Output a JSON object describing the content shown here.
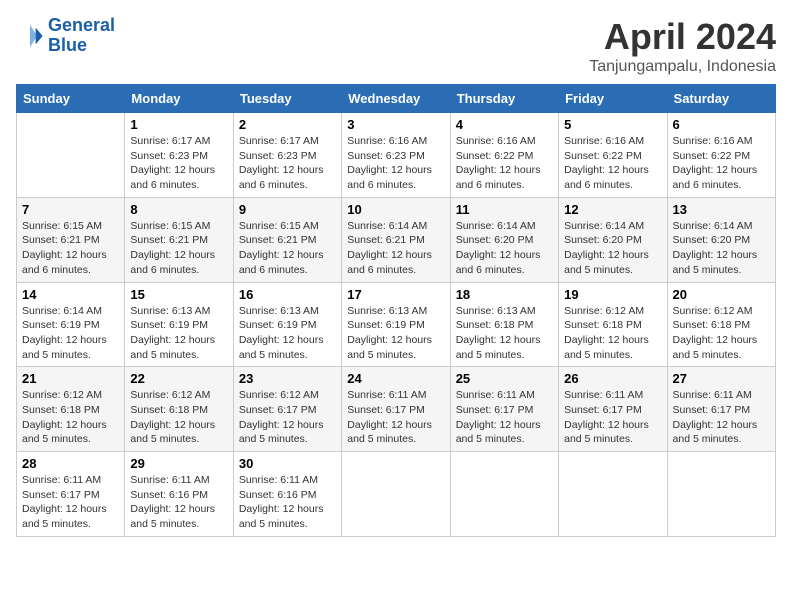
{
  "header": {
    "logo_line1": "General",
    "logo_line2": "Blue",
    "month": "April 2024",
    "location": "Tanjungampalu, Indonesia"
  },
  "columns": [
    "Sunday",
    "Monday",
    "Tuesday",
    "Wednesday",
    "Thursday",
    "Friday",
    "Saturday"
  ],
  "weeks": [
    [
      {
        "day": "",
        "sunrise": "",
        "sunset": "",
        "daylight": ""
      },
      {
        "day": "1",
        "sunrise": "Sunrise: 6:17 AM",
        "sunset": "Sunset: 6:23 PM",
        "daylight": "Daylight: 12 hours and 6 minutes."
      },
      {
        "day": "2",
        "sunrise": "Sunrise: 6:17 AM",
        "sunset": "Sunset: 6:23 PM",
        "daylight": "Daylight: 12 hours and 6 minutes."
      },
      {
        "day": "3",
        "sunrise": "Sunrise: 6:16 AM",
        "sunset": "Sunset: 6:23 PM",
        "daylight": "Daylight: 12 hours and 6 minutes."
      },
      {
        "day": "4",
        "sunrise": "Sunrise: 6:16 AM",
        "sunset": "Sunset: 6:22 PM",
        "daylight": "Daylight: 12 hours and 6 minutes."
      },
      {
        "day": "5",
        "sunrise": "Sunrise: 6:16 AM",
        "sunset": "Sunset: 6:22 PM",
        "daylight": "Daylight: 12 hours and 6 minutes."
      },
      {
        "day": "6",
        "sunrise": "Sunrise: 6:16 AM",
        "sunset": "Sunset: 6:22 PM",
        "daylight": "Daylight: 12 hours and 6 minutes."
      }
    ],
    [
      {
        "day": "7",
        "sunrise": "Sunrise: 6:15 AM",
        "sunset": "Sunset: 6:21 PM",
        "daylight": "Daylight: 12 hours and 6 minutes."
      },
      {
        "day": "8",
        "sunrise": "Sunrise: 6:15 AM",
        "sunset": "Sunset: 6:21 PM",
        "daylight": "Daylight: 12 hours and 6 minutes."
      },
      {
        "day": "9",
        "sunrise": "Sunrise: 6:15 AM",
        "sunset": "Sunset: 6:21 PM",
        "daylight": "Daylight: 12 hours and 6 minutes."
      },
      {
        "day": "10",
        "sunrise": "Sunrise: 6:14 AM",
        "sunset": "Sunset: 6:21 PM",
        "daylight": "Daylight: 12 hours and 6 minutes."
      },
      {
        "day": "11",
        "sunrise": "Sunrise: 6:14 AM",
        "sunset": "Sunset: 6:20 PM",
        "daylight": "Daylight: 12 hours and 6 minutes."
      },
      {
        "day": "12",
        "sunrise": "Sunrise: 6:14 AM",
        "sunset": "Sunset: 6:20 PM",
        "daylight": "Daylight: 12 hours and 5 minutes."
      },
      {
        "day": "13",
        "sunrise": "Sunrise: 6:14 AM",
        "sunset": "Sunset: 6:20 PM",
        "daylight": "Daylight: 12 hours and 5 minutes."
      }
    ],
    [
      {
        "day": "14",
        "sunrise": "Sunrise: 6:14 AM",
        "sunset": "Sunset: 6:19 PM",
        "daylight": "Daylight: 12 hours and 5 minutes."
      },
      {
        "day": "15",
        "sunrise": "Sunrise: 6:13 AM",
        "sunset": "Sunset: 6:19 PM",
        "daylight": "Daylight: 12 hours and 5 minutes."
      },
      {
        "day": "16",
        "sunrise": "Sunrise: 6:13 AM",
        "sunset": "Sunset: 6:19 PM",
        "daylight": "Daylight: 12 hours and 5 minutes."
      },
      {
        "day": "17",
        "sunrise": "Sunrise: 6:13 AM",
        "sunset": "Sunset: 6:19 PM",
        "daylight": "Daylight: 12 hours and 5 minutes."
      },
      {
        "day": "18",
        "sunrise": "Sunrise: 6:13 AM",
        "sunset": "Sunset: 6:18 PM",
        "daylight": "Daylight: 12 hours and 5 minutes."
      },
      {
        "day": "19",
        "sunrise": "Sunrise: 6:12 AM",
        "sunset": "Sunset: 6:18 PM",
        "daylight": "Daylight: 12 hours and 5 minutes."
      },
      {
        "day": "20",
        "sunrise": "Sunrise: 6:12 AM",
        "sunset": "Sunset: 6:18 PM",
        "daylight": "Daylight: 12 hours and 5 minutes."
      }
    ],
    [
      {
        "day": "21",
        "sunrise": "Sunrise: 6:12 AM",
        "sunset": "Sunset: 6:18 PM",
        "daylight": "Daylight: 12 hours and 5 minutes."
      },
      {
        "day": "22",
        "sunrise": "Sunrise: 6:12 AM",
        "sunset": "Sunset: 6:18 PM",
        "daylight": "Daylight: 12 hours and 5 minutes."
      },
      {
        "day": "23",
        "sunrise": "Sunrise: 6:12 AM",
        "sunset": "Sunset: 6:17 PM",
        "daylight": "Daylight: 12 hours and 5 minutes."
      },
      {
        "day": "24",
        "sunrise": "Sunrise: 6:11 AM",
        "sunset": "Sunset: 6:17 PM",
        "daylight": "Daylight: 12 hours and 5 minutes."
      },
      {
        "day": "25",
        "sunrise": "Sunrise: 6:11 AM",
        "sunset": "Sunset: 6:17 PM",
        "daylight": "Daylight: 12 hours and 5 minutes."
      },
      {
        "day": "26",
        "sunrise": "Sunrise: 6:11 AM",
        "sunset": "Sunset: 6:17 PM",
        "daylight": "Daylight: 12 hours and 5 minutes."
      },
      {
        "day": "27",
        "sunrise": "Sunrise: 6:11 AM",
        "sunset": "Sunset: 6:17 PM",
        "daylight": "Daylight: 12 hours and 5 minutes."
      }
    ],
    [
      {
        "day": "28",
        "sunrise": "Sunrise: 6:11 AM",
        "sunset": "Sunset: 6:17 PM",
        "daylight": "Daylight: 12 hours and 5 minutes."
      },
      {
        "day": "29",
        "sunrise": "Sunrise: 6:11 AM",
        "sunset": "Sunset: 6:16 PM",
        "daylight": "Daylight: 12 hours and 5 minutes."
      },
      {
        "day": "30",
        "sunrise": "Sunrise: 6:11 AM",
        "sunset": "Sunset: 6:16 PM",
        "daylight": "Daylight: 12 hours and 5 minutes."
      },
      {
        "day": "",
        "sunrise": "",
        "sunset": "",
        "daylight": ""
      },
      {
        "day": "",
        "sunrise": "",
        "sunset": "",
        "daylight": ""
      },
      {
        "day": "",
        "sunrise": "",
        "sunset": "",
        "daylight": ""
      },
      {
        "day": "",
        "sunrise": "",
        "sunset": "",
        "daylight": ""
      }
    ]
  ]
}
